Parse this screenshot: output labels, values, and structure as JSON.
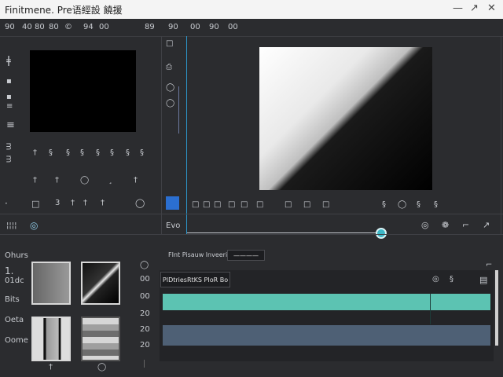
{
  "window": {
    "title": "Finitmene. Pre语經設 饒援",
    "minimize": "—",
    "maximize": "↗",
    "close": "✕"
  },
  "menu": [
    "90",
    "40",
    "80",
    "80",
    "©",
    "94",
    "00",
    "89"
  ],
  "menu_right": [
    "90",
    "00",
    "90",
    "00"
  ],
  "left_tools": [
    "ǂ",
    "▪",
    "▪",
    "≡",
    "·",
    "≡"
  ],
  "left_tools_bottom": [
    "ᴟ",
    "ᴟ"
  ],
  "mid_tools": [
    "□",
    "⎙",
    "◯",
    "◯"
  ],
  "icons_row1": [
    "†",
    "§",
    "§",
    "§",
    "§",
    "§",
    "§",
    "§"
  ],
  "icons_row2": [
    "†",
    "†",
    "◯",
    "¸",
    "†"
  ],
  "left_bottom": [
    "□",
    "3",
    "†",
    "†",
    "†",
    "◯"
  ],
  "panel_labels": {
    "tab": "¦¦¦¦",
    "tab_icon": "◎",
    "time": "Evo"
  },
  "bins_labels": [
    "Ohurs",
    "1.",
    "01dc",
    "Bits",
    "Oeta",
    "Oome"
  ],
  "bin_side": [
    "◯",
    "00",
    "00",
    "20",
    "20",
    "20"
  ],
  "preview_toolbar": [
    "□",
    "□",
    "□",
    "□",
    "□",
    "□",
    "□",
    "□",
    "□"
  ],
  "preview_right": [
    "◯",
    "§",
    "§",
    "§"
  ],
  "timeline_right_icons": [
    "◎",
    "❁",
    "⌐",
    "↗"
  ],
  "timeline": {
    "header_label": "FInt Pisauw lnveeris",
    "header_button": "————",
    "track_button": "PIDtriesRtKS PIoR Bo",
    "top_icons": [
      "◎",
      "§"
    ],
    "right_icon": "▤",
    "help_icon": "⌐"
  },
  "accent": "#2c96c9",
  "teal": "#5cc3b2",
  "slate": "#4e6075"
}
